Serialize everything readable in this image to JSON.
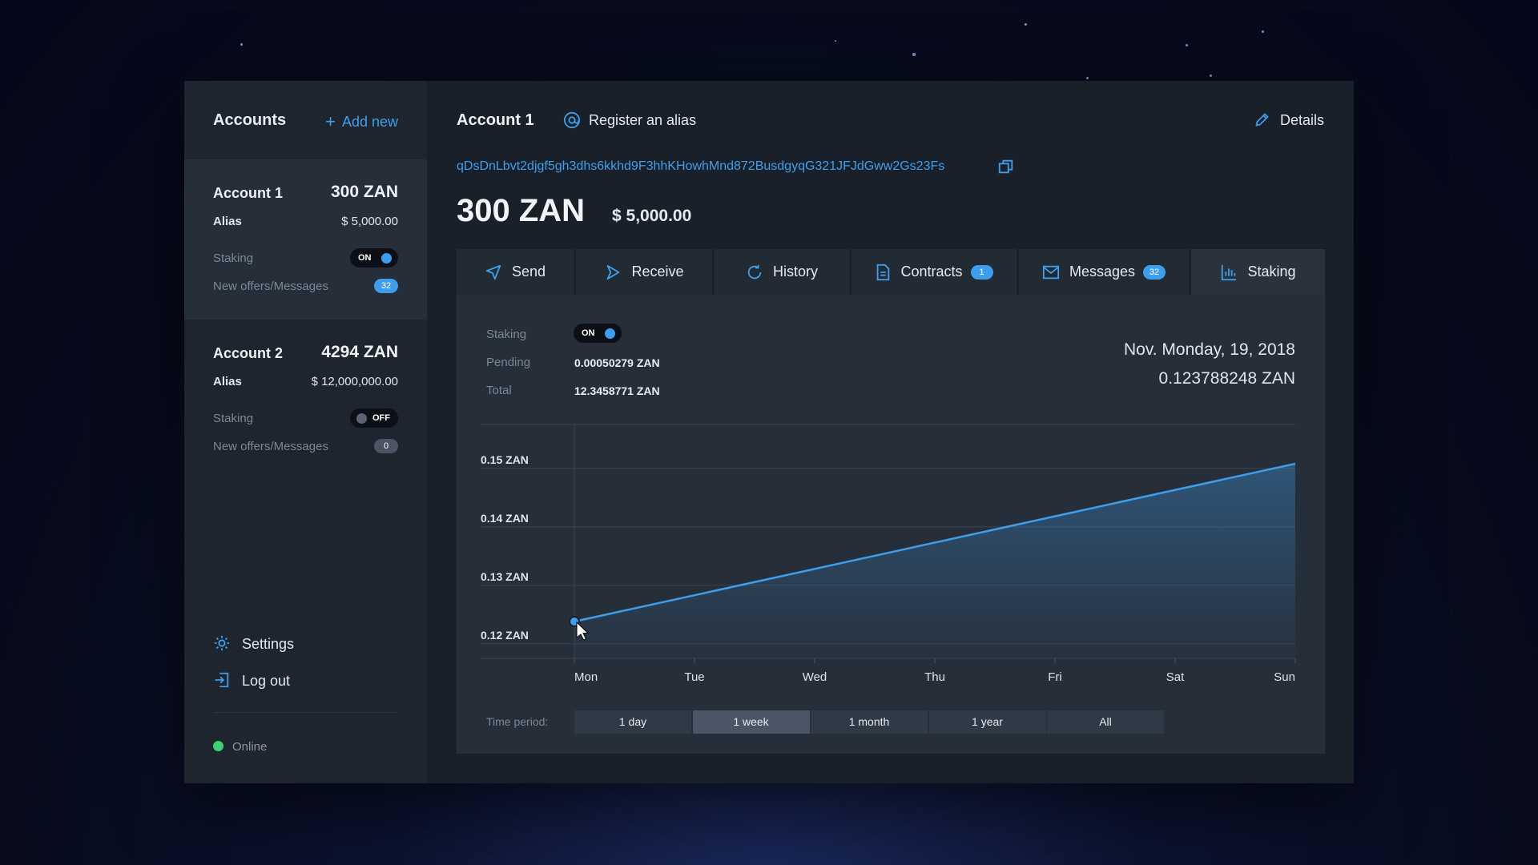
{
  "colors": {
    "accent": "#3f9eec",
    "online": "#3bd36f",
    "background": "#1a2029"
  },
  "sidebar": {
    "title": "Accounts",
    "add_new": "Add new",
    "accounts": [
      {
        "name": "Account 1",
        "balance": "300 ZAN",
        "alias_label": "Alias",
        "usd": "$ 5,000.00",
        "staking_label": "Staking",
        "staking_state": "ON",
        "offers_label": "New offers/Messages",
        "offers_count": "32",
        "active": true
      },
      {
        "name": "Account 2",
        "balance": "4294 ZAN",
        "alias_label": "Alias",
        "usd": "$ 12,000,000.00",
        "staking_label": "Staking",
        "staking_state": "OFF",
        "offers_label": "New offers/Messages",
        "offers_count": "0",
        "active": false
      }
    ],
    "settings": "Settings",
    "logout": "Log out",
    "status": "Online"
  },
  "main": {
    "title": "Account 1",
    "register_alias": "Register an alias",
    "details": "Details",
    "address": "qDsDnLbvt2djgf5gh3dhs6kkhd9F3hhKHowhMnd872BusdgyqG321JFJdGww2Gs23Fs",
    "balance": "300 ZAN",
    "balance_usd": "$ 5,000.00",
    "tabs": [
      {
        "label": "Send",
        "icon": "send-icon"
      },
      {
        "label": "Receive",
        "icon": "receive-icon"
      },
      {
        "label": "History",
        "icon": "history-icon"
      },
      {
        "label": "Contracts",
        "icon": "contracts-icon",
        "badge": "1"
      },
      {
        "label": "Messages",
        "icon": "messages-icon",
        "badge": "32"
      },
      {
        "label": "Staking",
        "icon": "staking-icon",
        "active": true
      }
    ],
    "staking": {
      "staking_label": "Staking",
      "staking_state": "ON",
      "pending_label": "Pending",
      "pending_value": "0.00050279 ZAN",
      "total_label": "Total",
      "total_value": "12.3458771 ZAN",
      "selected_date": "Nov. Monday, 19, 2018",
      "selected_value": "0.123788248 ZAN",
      "time_period_label": "Time period:",
      "periods": [
        "1 day",
        "1 week",
        "1 month",
        "1 year",
        "All"
      ],
      "selected_period": "1 week"
    }
  },
  "chart_data": {
    "type": "area",
    "categories": [
      "Mon",
      "Tue",
      "Wed",
      "Thu",
      "Fri",
      "Sat",
      "Sun"
    ],
    "values": [
      0.1238,
      0.1283,
      0.1328,
      0.1373,
      0.1418,
      0.1463,
      0.1508
    ],
    "y_ticks": [
      0.12,
      0.13,
      0.14,
      0.15
    ],
    "y_tick_labels": [
      "0.12 ZAN",
      "0.13 ZAN",
      "0.14 ZAN",
      "0.15 ZAN"
    ],
    "ylim": [
      0.1175,
      0.1575
    ],
    "grid": true,
    "highlighted_point": "Mon"
  }
}
